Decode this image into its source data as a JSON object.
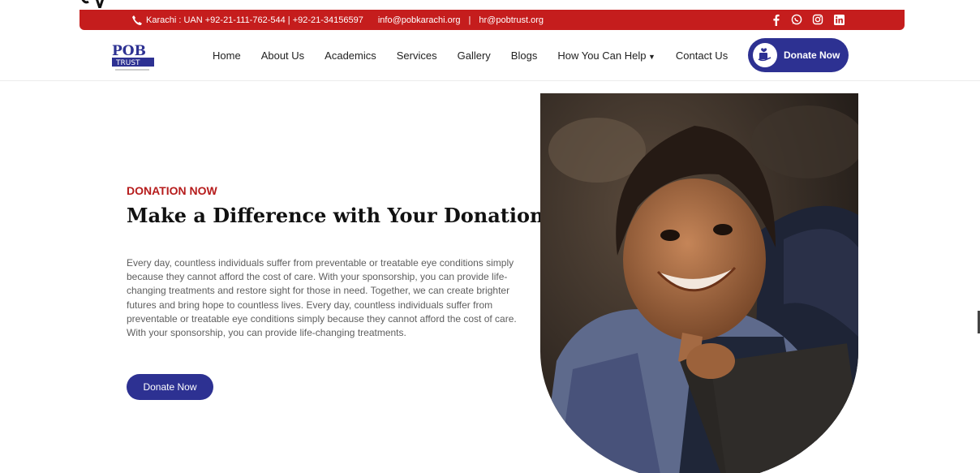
{
  "topbar": {
    "phone_text": "Karachi : UAN +92-21-111-762-544 | +92-21-34156597",
    "email1": "info@pobkarachi.org",
    "separator": "|",
    "email2": "hr@pobtrust.org",
    "bg_color": "#c51d1d"
  },
  "header": {
    "logo_text": "POB TRUST",
    "nav": [
      "Home",
      "About Us",
      "Academics",
      "Services",
      "Gallery",
      "Blogs",
      "How You Can Help",
      "Contact Us"
    ],
    "donate_label": "Donate Now",
    "accent": "#2d3192"
  },
  "hero": {
    "tag": "DONATION NOW",
    "title": "Make a Difference with Your Donation",
    "body": "Every day, countless individuals suffer from preventable or treatable eye conditions simply because they cannot afford the cost of care. With your sponsorship, you can provide life-changing treatments and restore sight for those in need. Together, we can create brighter futures and bring hope to countless lives. Every day, countless individuals suffer from preventable or treatable eye conditions simply because they cannot afford the cost of care. With your sponsorship, you can provide life-changing treatments.",
    "button": "Donate Now"
  },
  "icons": {
    "phone": "phone-icon",
    "social": [
      "facebook-icon",
      "whatsapp-icon",
      "instagram-icon",
      "linkedin-icon"
    ]
  }
}
